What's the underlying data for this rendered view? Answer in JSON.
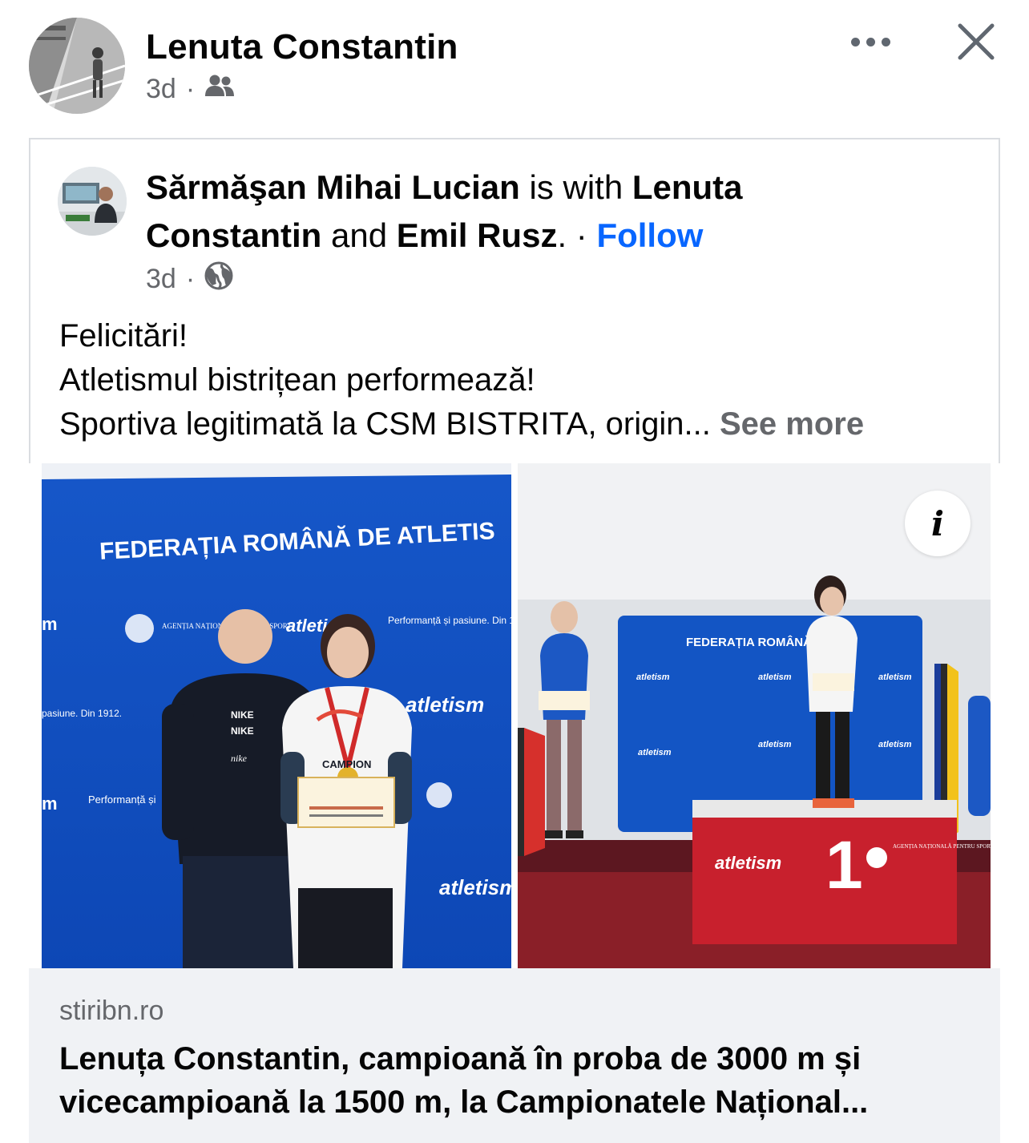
{
  "post": {
    "author": "Lenuta Constantin",
    "time": "3d",
    "separator": "·",
    "audience_icon": "friends-icon"
  },
  "shared_post": {
    "author": "Sărmăşan Mihai Lucian",
    "with_text": " is with ",
    "tag1_line1": "Lenuta",
    "tag1_line2": "Constantin",
    "and_text": " and ",
    "tag2": "Emil Rusz",
    "period": ".",
    "separator": " · ",
    "follow_label": "Follow",
    "time": "3d",
    "audience_icon": "globe-icon",
    "text_lines": [
      "Felicitări!",
      "Atletismul bistrițean performează!",
      "Sportiva legitimată la CSM BISTRITA, origin... "
    ],
    "see_more_label": "See more"
  },
  "photos": {
    "left": {
      "banner_text": "FEDERAȚIA ROMÂNĂ DE ATLETIS",
      "brand": "atletism",
      "slogan": "Performanță și pasiune. Din 1912.",
      "agency": "AGENȚIA NAȚIONALĂ PENTRU SPORT",
      "shirt_text": "NIKE",
      "campion_text": "CAMPION"
    },
    "right": {
      "banner_text": "FEDERAȚIA ROMÂNĂ",
      "brand": "atletism",
      "podium_number": "1",
      "agency": "AGENȚIA NAȚIONALĂ PENTRU SPORT"
    },
    "info_icon": "info-icon"
  },
  "link_preview": {
    "domain": "stiribn.ro",
    "title_line1": "Lenuța Constantin, campioană în proba de 3000 m și",
    "title_line2": "vicecampioană la 1500 m, la Campionatele Național..."
  }
}
